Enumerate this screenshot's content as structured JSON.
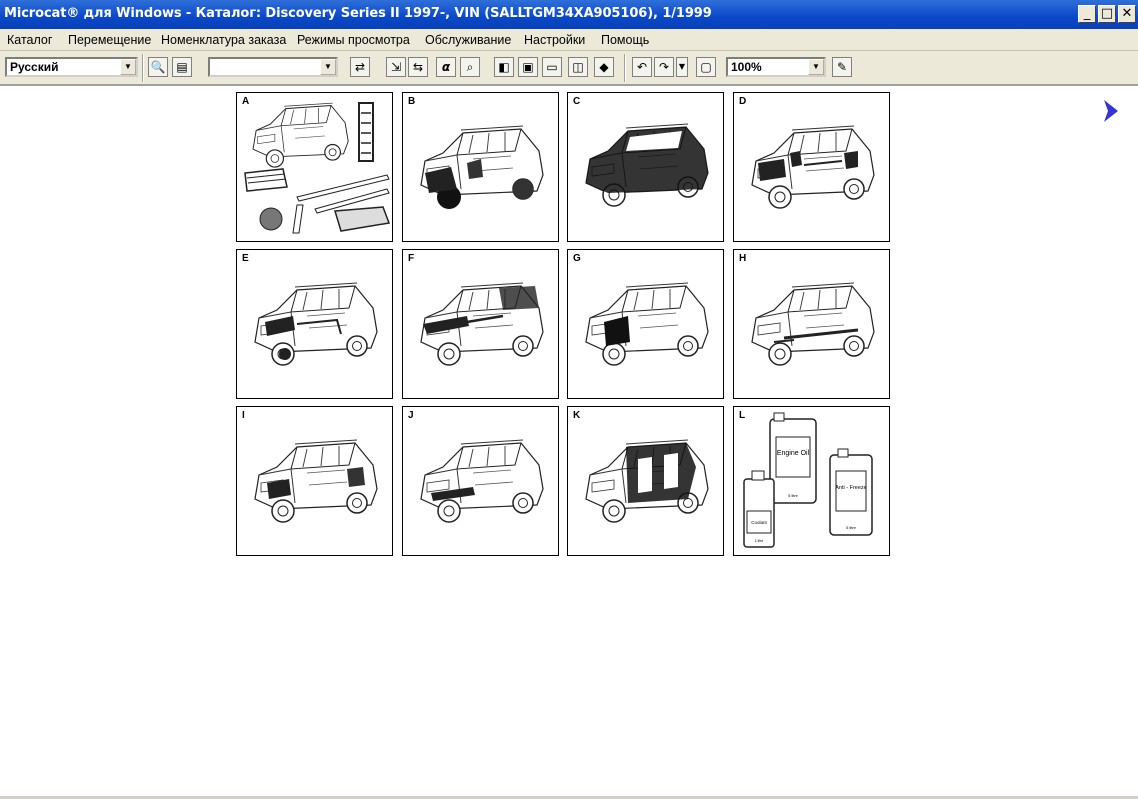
{
  "window": {
    "title": "Microcat® для Windows - Каталог: Discovery Series II 1997-, VIN (SALLTGM34XA905106), 1/1999",
    "minimize": "_",
    "maximize": "□",
    "close": "✕"
  },
  "menu": [
    "Каталог",
    "Перемещение",
    "Номенклатура заказа",
    "Режимы просмотра",
    "Обслуживание",
    "Настройки",
    "Помощь"
  ],
  "toolbar": {
    "language": "Русский",
    "search_value": "",
    "alpha": "α",
    "zoom": "100%"
  },
  "groups": [
    {
      "letter": "A"
    },
    {
      "letter": "B"
    },
    {
      "letter": "C"
    },
    {
      "letter": "D"
    },
    {
      "letter": "E"
    },
    {
      "letter": "F"
    },
    {
      "letter": "G"
    },
    {
      "letter": "H"
    },
    {
      "letter": "I"
    },
    {
      "letter": "J"
    },
    {
      "letter": "K"
    },
    {
      "letter": "L",
      "labels": {
        "engine": "Engine Oil",
        "antifreeze": "Anti - Freeze",
        "coolant": "Coolant",
        "size1": "5 litre",
        "size2": "5 litre",
        "size3": "1 litre"
      }
    }
  ],
  "colors": {
    "accent": "#0a48c8",
    "arrow": "#3434d8"
  }
}
